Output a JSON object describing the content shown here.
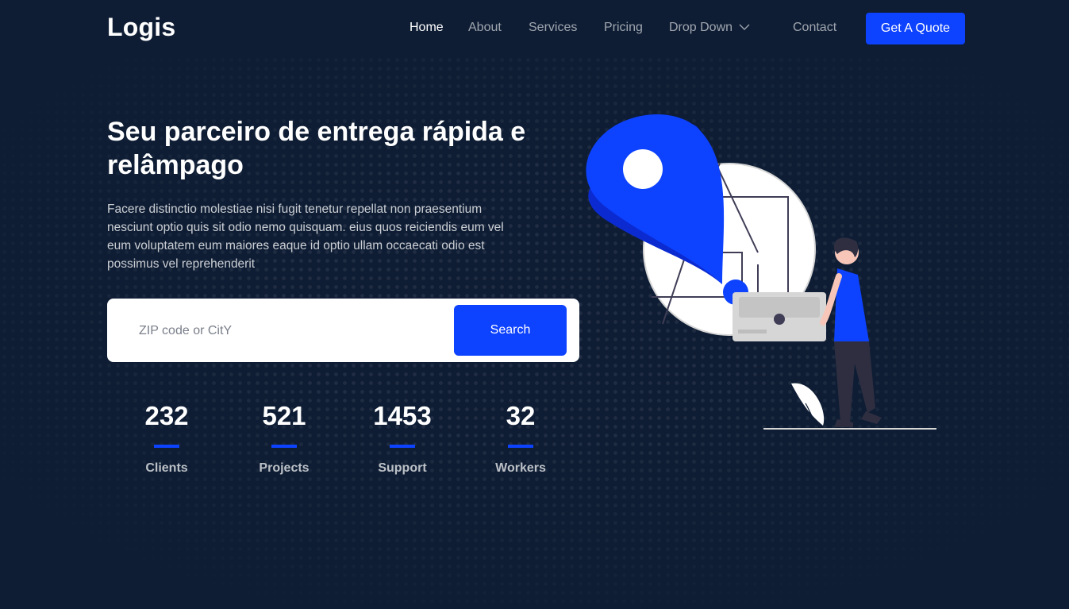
{
  "header": {
    "logo": "Logis",
    "nav": [
      {
        "label": "Home",
        "active": true
      },
      {
        "label": "About"
      },
      {
        "label": "Services"
      },
      {
        "label": "Pricing"
      },
      {
        "label": "Drop Down"
      },
      {
        "label": "Contact"
      }
    ],
    "cta": "Get A Quote"
  },
  "hero": {
    "title": "Seu parceiro de entrega rápida e relâmpago",
    "description": "Facere distinctio molestiae nisi fugit tenetur repellat non praesentium nesciunt optio quis sit odio nemo quisquam. eius quos reiciendis eum vel eum voluptatem eum maiores eaque id optio ullam occaecati odio est possimus vel reprehenderit"
  },
  "search": {
    "placeholder": "ZIP code or CitY",
    "value": "",
    "button": "Search"
  },
  "stats": [
    {
      "value": "232",
      "label": "Clients"
    },
    {
      "value": "521",
      "label": "Projects"
    },
    {
      "value": "1453",
      "label": "Support"
    },
    {
      "value": "32",
      "label": "Workers"
    }
  ],
  "colors": {
    "background": "#0e1d34",
    "accent": "#0d42ff",
    "text": "#ffffff"
  },
  "icons": {
    "dropdown": "chevron-down-icon",
    "illustration": "delivery-location-pin-illustration"
  }
}
